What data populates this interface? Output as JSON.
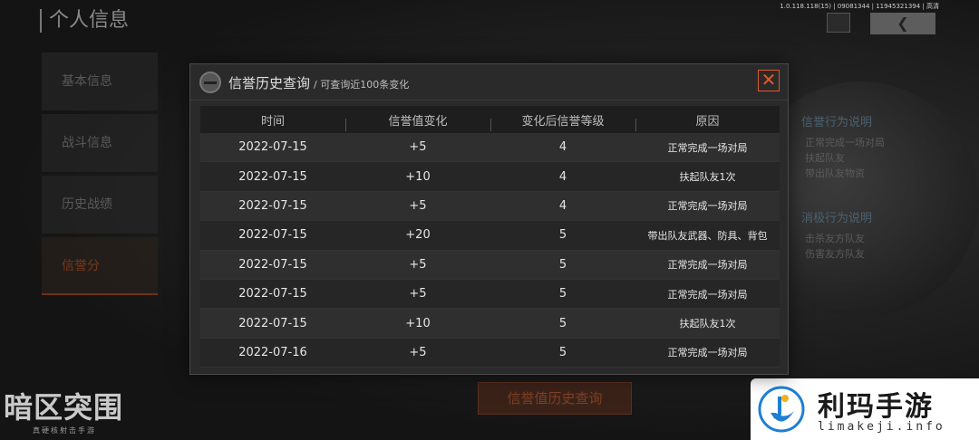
{
  "app": {
    "page_title": "个人信息",
    "build_info": "1.0.118.118(15) | 09081344 | 11945321394 | 高清",
    "back_icon": "chevron-left-icon"
  },
  "sidebar": {
    "items": [
      {
        "label": "基本信息",
        "active": false
      },
      {
        "label": "战斗信息",
        "active": false
      },
      {
        "label": "历史战绩",
        "active": false
      },
      {
        "label": "信誉分",
        "active": true
      }
    ]
  },
  "right_panel": {
    "positive_heading": "信誉行为说明",
    "positive_lines": [
      "正常完成一场对局",
      "扶起队友",
      "带出队友物资"
    ],
    "negative_heading": "消极行为说明",
    "negative_lines": [
      "击杀友方队友",
      "伤害友方队友"
    ]
  },
  "bottom_button": {
    "label": "信誉值历史查询"
  },
  "game_logo": {
    "title": "暗区突围",
    "subtitle": "真硬核射击手游"
  },
  "watermark": {
    "title": "利玛手游",
    "url": "limakeji.info",
    "brand_color": "#1f7fd6"
  },
  "modal": {
    "title": "信誉历史查询",
    "subtitle": "/ 可查询近100条变化",
    "close_icon": "close-icon",
    "accent_color": "#e05a2a",
    "columns": [
      "时间",
      "信誉值变化",
      "变化后信誉等级",
      "原因"
    ],
    "rows": [
      {
        "date": "2022-07-15",
        "change": "+5",
        "level": "4",
        "reason": "正常完成一场对局"
      },
      {
        "date": "2022-07-15",
        "change": "+10",
        "level": "4",
        "reason": "扶起队友1次"
      },
      {
        "date": "2022-07-15",
        "change": "+5",
        "level": "4",
        "reason": "正常完成一场对局"
      },
      {
        "date": "2022-07-15",
        "change": "+20",
        "level": "5",
        "reason": "带出队友武器、防具、背包"
      },
      {
        "date": "2022-07-15",
        "change": "+5",
        "level": "5",
        "reason": "正常完成一场对局"
      },
      {
        "date": "2022-07-15",
        "change": "+5",
        "level": "5",
        "reason": "正常完成一场对局"
      },
      {
        "date": "2022-07-15",
        "change": "+10",
        "level": "5",
        "reason": "扶起队友1次"
      },
      {
        "date": "2022-07-16",
        "change": "+5",
        "level": "5",
        "reason": "正常完成一场对局"
      }
    ]
  }
}
